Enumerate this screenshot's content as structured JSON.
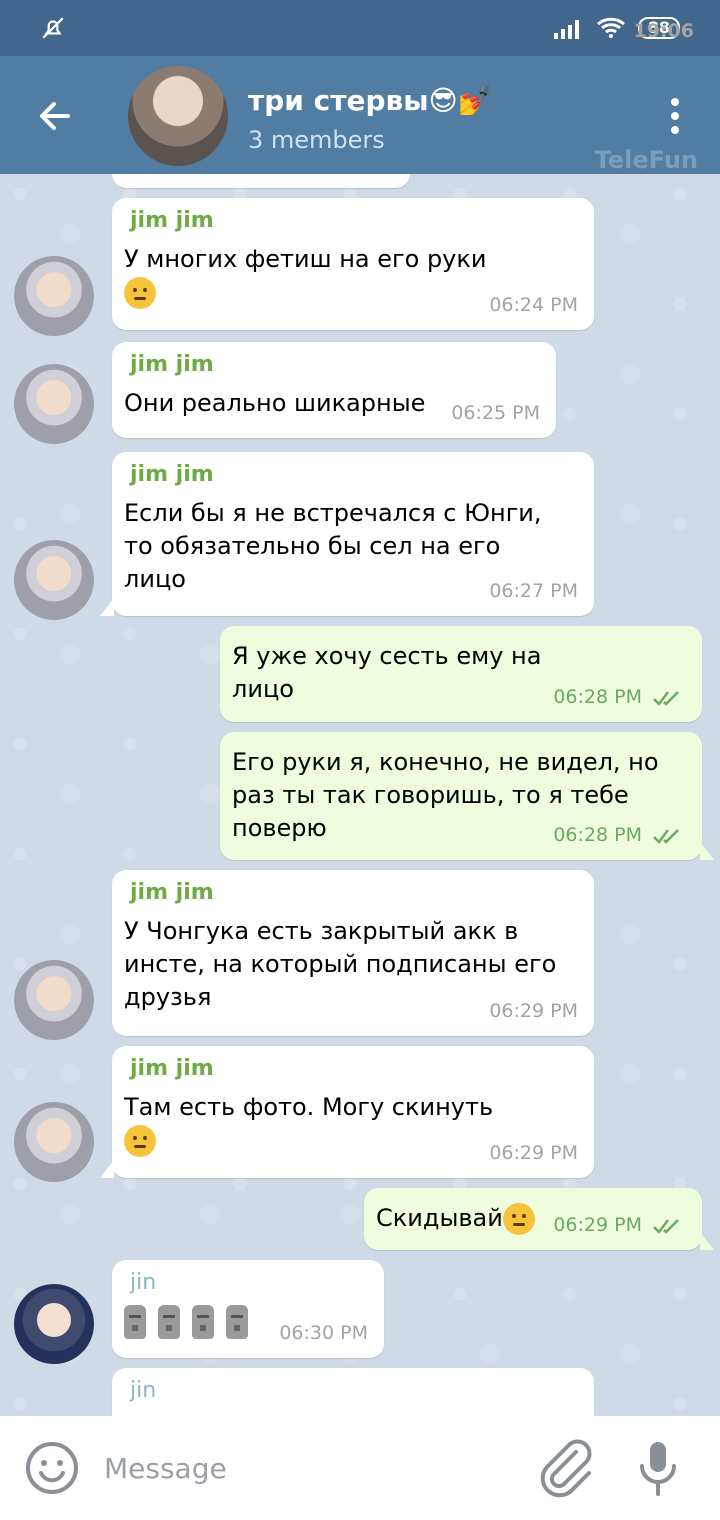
{
  "status_bar": {
    "time": "19:06",
    "battery": "88"
  },
  "header": {
    "title": "три стервы😎💅",
    "subtitle": "3 members",
    "watermark": "TeleFun"
  },
  "messages": [
    {
      "sender": "jim jim",
      "text": "У многих фетиш на его руки",
      "time": "06:24 PM"
    },
    {
      "sender": "jim jim",
      "text": "Они реально шикарные",
      "time": "06:25 PM"
    },
    {
      "sender": "jim jim",
      "text": "Если бы я не встречался с Юнги, то обязательно бы сел на его лицо",
      "time": "06:27 PM"
    },
    {
      "sender": "",
      "text": "Я уже хочу сесть ему на лицо",
      "time": "06:28 PM"
    },
    {
      "sender": "",
      "text": "Его руки я, конечно, не видел, но раз ты так говоришь, то я тебе поверю",
      "time": "06:28 PM"
    },
    {
      "sender": "jim jim",
      "text": "У Чонгука есть закрытый акк в инсте, на который подписаны его друзья",
      "time": "06:29 PM"
    },
    {
      "sender": "jim jim",
      "text": "Там есть фото. Могу скинуть",
      "time": "06:29 PM"
    },
    {
      "sender": "",
      "text": "Скидывай",
      "time": "06:29 PM"
    },
    {
      "sender": "jin",
      "text": "",
      "time": "06:30 PM"
    },
    {
      "sender": "jin",
      "text": "",
      "time": ""
    }
  ],
  "input": {
    "placeholder": "Message"
  }
}
